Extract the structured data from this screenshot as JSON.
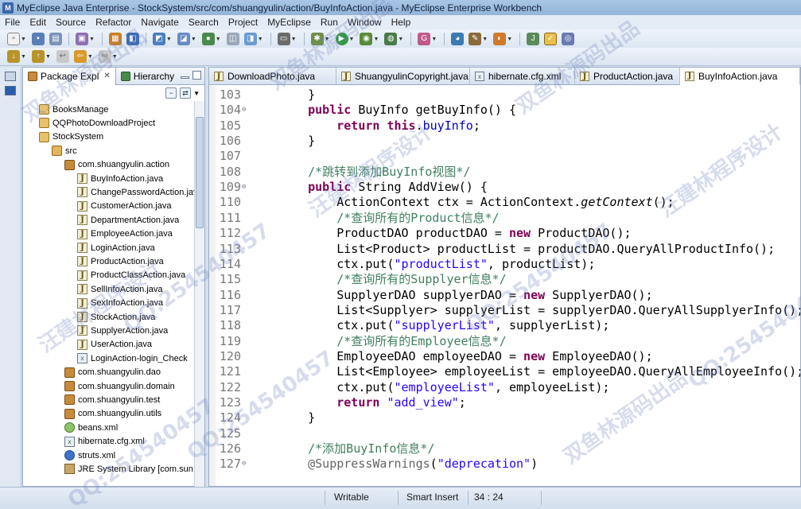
{
  "window": {
    "title": "MyEclipse Java Enterprise - StockSystem/src/com/shuangyulin/action/BuyInfoAction.java - MyEclipse Enterprise Workbench"
  },
  "menubar": [
    "File",
    "Edit",
    "Source",
    "Refactor",
    "Navigate",
    "Search",
    "Project",
    "MyEclipse",
    "Run",
    "Window",
    "Help"
  ],
  "explorer": {
    "tabs": [
      {
        "label": "Package Expl",
        "icon": "package-explorer-icon"
      },
      {
        "label": "Hierarchy",
        "icon": "hierarchy-icon"
      }
    ],
    "tree": [
      {
        "label": "BooksManage",
        "icon": "project",
        "level": 1
      },
      {
        "label": "QQPhotoDownloadProject",
        "icon": "project",
        "level": 1
      },
      {
        "label": "StockSystem",
        "icon": "project",
        "level": 1
      },
      {
        "label": "src",
        "icon": "src",
        "level": 2
      },
      {
        "label": "com.shuangyulin.action",
        "icon": "pkg",
        "level": 3
      },
      {
        "label": "BuyInfoAction.java",
        "icon": "java",
        "level": 4
      },
      {
        "label": "ChangePasswordAction.java",
        "icon": "java",
        "level": 4
      },
      {
        "label": "CustomerAction.java",
        "icon": "java",
        "level": 4
      },
      {
        "label": "DepartmentAction.java",
        "icon": "java",
        "level": 4
      },
      {
        "label": "EmployeeAction.java",
        "icon": "java",
        "level": 4
      },
      {
        "label": "LoginAction.java",
        "icon": "java",
        "level": 4
      },
      {
        "label": "ProductAction.java",
        "icon": "java",
        "level": 4
      },
      {
        "label": "ProductClassAction.java",
        "icon": "java",
        "level": 4
      },
      {
        "label": "SellInfoAction.java",
        "icon": "java",
        "level": 4
      },
      {
        "label": "SexInfoAction.java",
        "icon": "java",
        "level": 4
      },
      {
        "label": "StockAction.java",
        "icon": "java",
        "level": 4
      },
      {
        "label": "SupplyerAction.java",
        "icon": "java",
        "level": 4
      },
      {
        "label": "UserAction.java",
        "icon": "java",
        "level": 4
      },
      {
        "label": "LoginAction-login_Check",
        "icon": "xml",
        "level": 4
      },
      {
        "label": "com.shuangyulin.dao",
        "icon": "pkg",
        "level": 3
      },
      {
        "label": "com.shuangyulin.domain",
        "icon": "pkg",
        "level": 3
      },
      {
        "label": "com.shuangyulin.test",
        "icon": "pkg",
        "level": 3
      },
      {
        "label": "com.shuangyulin.utils",
        "icon": "pkg",
        "level": 3
      },
      {
        "label": "beans.xml",
        "icon": "beans",
        "level": 3
      },
      {
        "label": "hibernate.cfg.xml",
        "icon": "xml",
        "level": 3
      },
      {
        "label": "struts.xml",
        "icon": "struts",
        "level": 3
      },
      {
        "label": "JRE System Library [com.sun.java",
        "icon": "lib",
        "level": 3
      }
    ]
  },
  "editor": {
    "tabs": [
      {
        "label": "DownloadPhoto.java",
        "active": false
      },
      {
        "label": "ShuangyulinCopyright.java",
        "active": false
      },
      {
        "label": "hibernate.cfg.xml",
        "active": false
      },
      {
        "label": "ProductAction.java",
        "active": false
      },
      {
        "label": "BuyInfoAction.java",
        "active": true
      }
    ],
    "lines": [
      {
        "n": "103",
        "fold": false,
        "segs": [
          [
            "",
            "    }"
          ]
        ]
      },
      {
        "n": "104",
        "fold": true,
        "segs": [
          [
            "",
            "    "
          ],
          [
            "kw",
            "public"
          ],
          [
            "",
            " BuyInfo getBuyInfo() {"
          ]
        ]
      },
      {
        "n": "105",
        "fold": false,
        "segs": [
          [
            "",
            "        "
          ],
          [
            "kw",
            "return"
          ],
          [
            "",
            " "
          ],
          [
            "kw",
            "this"
          ],
          [
            "",
            "."
          ],
          [
            "fld",
            "buyInfo"
          ],
          [
            "",
            ";"
          ]
        ]
      },
      {
        "n": "106",
        "fold": false,
        "segs": [
          [
            "",
            "    }"
          ]
        ]
      },
      {
        "n": "107",
        "fold": false,
        "segs": [
          [
            "",
            ""
          ]
        ]
      },
      {
        "n": "108",
        "fold": false,
        "segs": [
          [
            "",
            "    "
          ],
          [
            "cmt",
            "/*跳转到添加BuyInfo视图*/"
          ]
        ]
      },
      {
        "n": "109",
        "fold": true,
        "segs": [
          [
            "",
            "    "
          ],
          [
            "kw",
            "public"
          ],
          [
            "",
            " String AddView() {"
          ]
        ]
      },
      {
        "n": "110",
        "fold": false,
        "segs": [
          [
            "",
            "        ActionContext ctx = ActionContext."
          ],
          [
            "ital",
            "getContext"
          ],
          [
            "",
            "();"
          ]
        ]
      },
      {
        "n": "111",
        "fold": false,
        "segs": [
          [
            "",
            "        "
          ],
          [
            "cmt",
            "/*查询所有的Product信息*/"
          ]
        ]
      },
      {
        "n": "112",
        "fold": false,
        "segs": [
          [
            "",
            "        ProductDAO productDAO = "
          ],
          [
            "kw",
            "new"
          ],
          [
            "",
            " ProductDAO();"
          ]
        ]
      },
      {
        "n": "113",
        "fold": false,
        "segs": [
          [
            "",
            "        List<Product> productList = productDAO.QueryAllProductInfo();"
          ]
        ]
      },
      {
        "n": "114",
        "fold": false,
        "segs": [
          [
            "",
            "        ctx.put("
          ],
          [
            "str",
            "\"productList\""
          ],
          [
            "",
            ", productList);"
          ]
        ]
      },
      {
        "n": "115",
        "fold": false,
        "segs": [
          [
            "",
            "        "
          ],
          [
            "cmt",
            "/*查询所有的Supplyer信息*/"
          ]
        ]
      },
      {
        "n": "116",
        "fold": false,
        "segs": [
          [
            "",
            "        SupplyerDAO supplyerDAO = "
          ],
          [
            "kw",
            "new"
          ],
          [
            "",
            " SupplyerDAO();"
          ]
        ]
      },
      {
        "n": "117",
        "fold": false,
        "segs": [
          [
            "",
            "        List<Supplyer> supplyerList = supplyerDAO.QueryAllSupplyerInfo();"
          ]
        ]
      },
      {
        "n": "118",
        "fold": false,
        "segs": [
          [
            "",
            "        ctx.put("
          ],
          [
            "str",
            "\"supplyerList\""
          ],
          [
            "",
            ", supplyerList);"
          ]
        ]
      },
      {
        "n": "119",
        "fold": false,
        "segs": [
          [
            "",
            "        "
          ],
          [
            "cmt",
            "/*查询所有的Employee信息*/"
          ]
        ]
      },
      {
        "n": "120",
        "fold": false,
        "segs": [
          [
            "",
            "        EmployeeDAO employeeDAO = "
          ],
          [
            "kw",
            "new"
          ],
          [
            "",
            " EmployeeDAO();"
          ]
        ]
      },
      {
        "n": "121",
        "fold": false,
        "segs": [
          [
            "",
            "        List<Employee> employeeList = employeeDAO.QueryAllEmployeeInfo();"
          ]
        ]
      },
      {
        "n": "122",
        "fold": false,
        "segs": [
          [
            "",
            "        ctx.put("
          ],
          [
            "str",
            "\"employeeList\""
          ],
          [
            "",
            ", employeeList);"
          ]
        ]
      },
      {
        "n": "123",
        "fold": false,
        "segs": [
          [
            "",
            "        "
          ],
          [
            "kw",
            "return"
          ],
          [
            "",
            " "
          ],
          [
            "str",
            "\"add_view\""
          ],
          [
            "",
            ";"
          ]
        ]
      },
      {
        "n": "124",
        "fold": false,
        "segs": [
          [
            "",
            "    }"
          ]
        ]
      },
      {
        "n": "125",
        "fold": false,
        "segs": [
          [
            "",
            ""
          ]
        ]
      },
      {
        "n": "126",
        "fold": false,
        "segs": [
          [
            "",
            "    "
          ],
          [
            "cmt",
            "/*添加BuyInfo信息*/"
          ]
        ]
      },
      {
        "n": "127",
        "fold": true,
        "segs": [
          [
            "",
            "    "
          ],
          [
            "ann",
            "@SuppressWarnings"
          ],
          [
            "",
            "("
          ],
          [
            "str",
            "\"deprecation\""
          ],
          [
            "",
            ")"
          ]
        ]
      }
    ]
  },
  "statusbar": {
    "writable": "Writable",
    "insert_mode": "Smart Insert",
    "position": "34 : 24"
  },
  "watermarks": [
    "双鱼林源码出品",
    "QQ:254540457",
    "汪建林程序设计",
    "双鱼林源码出品",
    "QQ:254540457",
    "汪建林程序设计",
    "QQ:254540457",
    "双鱼林源码出品",
    "汪建林程序设计",
    "QQ:254540457",
    "双鱼林源码出品",
    "QQ:254540457"
  ]
}
